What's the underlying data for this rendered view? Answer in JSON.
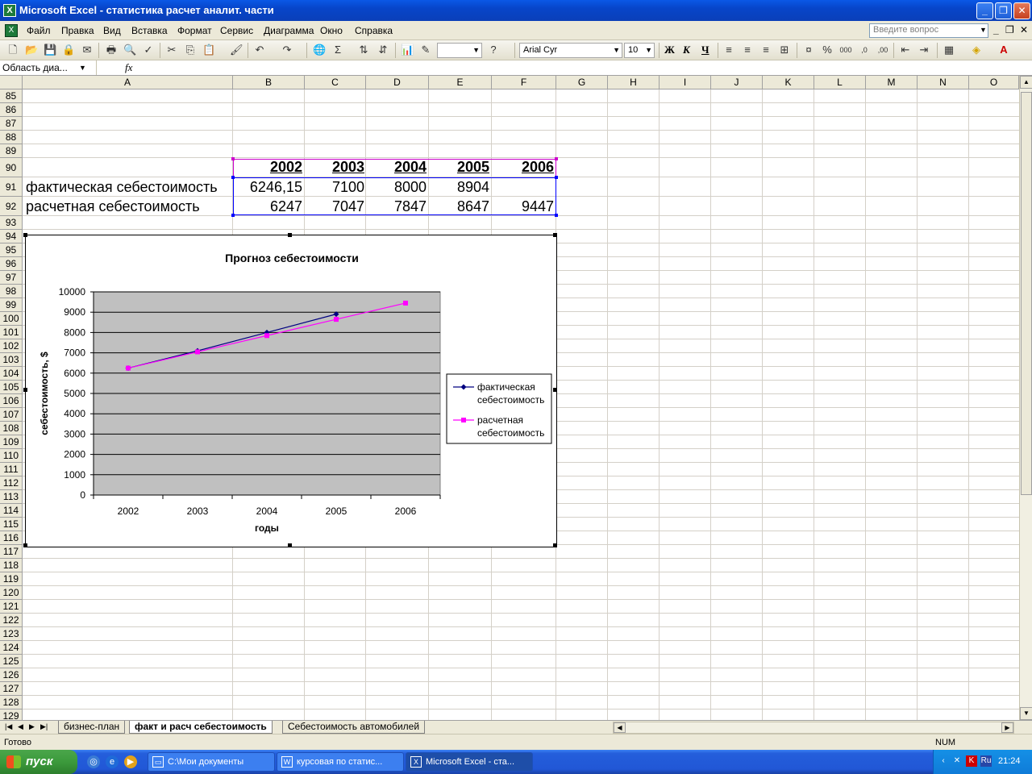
{
  "window": {
    "title": "Microsoft Excel - статистика расчет аналит. части",
    "controls": {
      "minimize": "_",
      "restore": "❐",
      "close": "✕"
    }
  },
  "menu": {
    "items": [
      "Файл",
      "Правка",
      "Вид",
      "Вставка",
      "Формат",
      "Сервис",
      "Диаграмма",
      "Окно",
      "Справка"
    ],
    "ask_placeholder": "Введите вопрос"
  },
  "toolbar": {
    "font_name": "Arial Cyr",
    "font_size": "10",
    "bold": "Ж",
    "italic": "К",
    "underline": "Ч"
  },
  "formula_bar": {
    "name_box": "Область диа...",
    "fx": "fx"
  },
  "grid": {
    "columns": [
      "A",
      "B",
      "C",
      "D",
      "E",
      "F",
      "G",
      "H",
      "I",
      "J",
      "K",
      "L",
      "M",
      "N",
      "O"
    ],
    "rows": [
      "85",
      "86",
      "87",
      "88",
      "89",
      "90",
      "91",
      "92",
      "93",
      "94",
      "95",
      "96",
      "97",
      "98",
      "99",
      "100",
      "101",
      "102",
      "103",
      "104",
      "105",
      "106",
      "107",
      "108",
      "109",
      "110",
      "111",
      "112",
      "113",
      "114",
      "115",
      "116",
      "117",
      "118",
      "119",
      "120",
      "121",
      "122",
      "123",
      "124",
      "125",
      "126",
      "127",
      "128",
      "129"
    ],
    "table": {
      "years": [
        "2002",
        "2003",
        "2004",
        "2005",
        "2006"
      ],
      "actual_label": "фактическая себестоимость",
      "actual_values": [
        "6246,15",
        "7100",
        "8000",
        "8904",
        ""
      ],
      "calc_label": "расчетная себестоимость",
      "calc_values": [
        "6247",
        "7047",
        "7847",
        "8647",
        "9447"
      ]
    }
  },
  "chart_data": {
    "type": "line",
    "title": "Прогноз себестоимости",
    "xlabel": "годы",
    "ylabel": "себестоимость, $",
    "categories": [
      "2002",
      "2003",
      "2004",
      "2005",
      "2006"
    ],
    "ylim": [
      0,
      10000
    ],
    "yticks": [
      "0",
      "1000",
      "2000",
      "3000",
      "4000",
      "5000",
      "6000",
      "7000",
      "8000",
      "9000",
      "10000"
    ],
    "grid": true,
    "legend_position": "right",
    "series": [
      {
        "name": "фактическая себестоимость",
        "legend_lines": [
          "фактическая",
          "себестоимость"
        ],
        "values": [
          6246.15,
          7100,
          8000,
          8904,
          null
        ],
        "color": "#000080",
        "marker": "diamond"
      },
      {
        "name": "расчетная себестоимость",
        "legend_lines": [
          "расчетная",
          "себестоимость"
        ],
        "values": [
          6247,
          7047,
          7847,
          8647,
          9447
        ],
        "color": "#ff00ff",
        "marker": "square"
      }
    ],
    "plot_bg": "#c0c0c0"
  },
  "sheets": {
    "tabs": [
      "бизнес-план",
      "факт и расч себестоимость",
      "Себестоимость автомобилей"
    ],
    "active": "факт и расч себестоимость"
  },
  "status": {
    "text": "Готово",
    "num": "NUM"
  },
  "taskbar": {
    "start": "пуск",
    "buttons": [
      "C:\\Мои документы",
      "курсовая по статис...",
      "Microsoft Excel - ста..."
    ],
    "lang": "Ru",
    "clock": "21:24"
  }
}
